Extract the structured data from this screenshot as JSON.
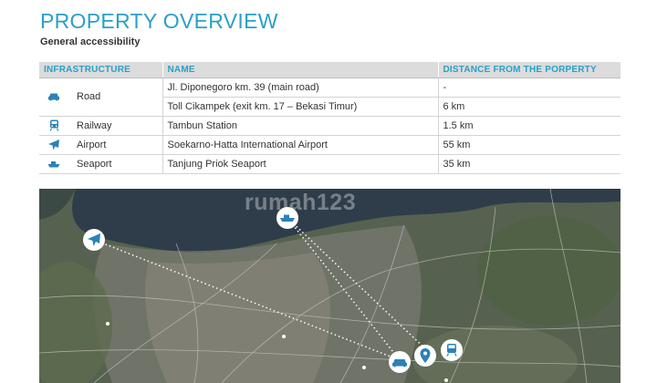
{
  "page": {
    "title": "PROPERTY OVERVIEW",
    "subtitle": "General accessibility"
  },
  "table": {
    "headers": [
      "INFRASTRUCTURE",
      "NAME",
      "DISTANCE FROM THE PORPERTY"
    ],
    "road": {
      "label": "Road",
      "icon": "car-icon",
      "rows": [
        {
          "name": "Jl. Diponegoro km. 39 (main road)",
          "distance": "-"
        },
        {
          "name": "Toll Cikampek (exit km. 17 – Bekasi Timur)",
          "distance": "6 km"
        }
      ]
    },
    "railway": {
      "label": "Railway",
      "icon": "train-icon",
      "name": "Tambun Station",
      "distance": "1.5 km"
    },
    "airport": {
      "label": "Airport",
      "icon": "airplane-icon",
      "name": "Soekarno-Hatta International Airport",
      "distance": "55 km"
    },
    "seaport": {
      "label": "Seaport",
      "icon": "ship-icon",
      "name": "Tanjung Priok Seaport",
      "distance": "35 km"
    }
  },
  "map": {
    "watermark": "rumah123",
    "accent": "#2a9fc9",
    "markers": [
      "airplane-marker",
      "ship-marker",
      "car-marker",
      "location-pin-marker",
      "train-marker"
    ]
  }
}
